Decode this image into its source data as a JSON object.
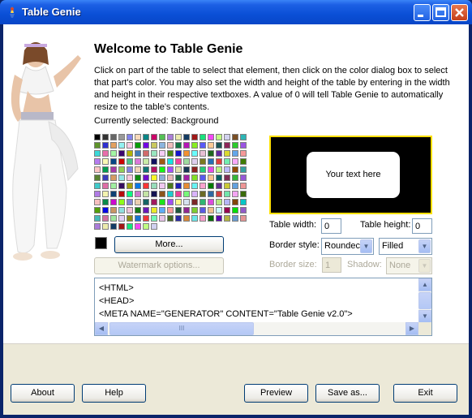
{
  "window": {
    "title": "Table Genie",
    "icon": "table-genie-app-icon"
  },
  "titlebar_buttons": {
    "minimize": "minimize-icon",
    "maximize": "maximize-icon",
    "close": "close-icon"
  },
  "main": {
    "heading": "Welcome to Table Genie",
    "description": "Click on part of the table to select that element, then click on the color dialog box to select that part's color. You may also set the width and height of the table by entering in the width and height in their respective textboxes. A value of 0 will tell Table Genie to automatically resize to the table's contents.",
    "currently_selected": "Currently selected: Background",
    "current_color": "#000000",
    "more_button": "More...",
    "watermark_button": "Watermark options..."
  },
  "preview": {
    "cell_text": "Your text here",
    "background": "#000000",
    "border_color": "#ffe000"
  },
  "form": {
    "table_width_label": "Table width:",
    "table_width_value": "0",
    "table_height_label": "Table height:",
    "table_height_value": "0",
    "border_style_label": "Border style:",
    "border_style_value": "Roundec",
    "border_fill_value": "Filled",
    "border_size_label": "Border size:",
    "border_size_value": "1",
    "shadow_label": "Shadow:",
    "shadow_value": "None"
  },
  "code": {
    "lines": [
      "<HTML>",
      "<HEAD>",
      "<META NAME=\"GENERATOR\" CONTENT=\"Table Genie v2.0\">"
    ],
    "hscroll_thumb_grip": "III"
  },
  "footer": {
    "about": "About",
    "help": "Help",
    "preview": "Preview",
    "save_as": "Save as...",
    "exit": "Exit"
  }
}
